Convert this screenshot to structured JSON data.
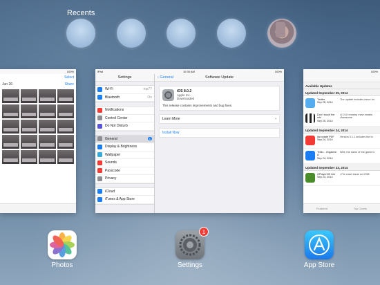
{
  "recents": {
    "title": "Recents",
    "contacts": 5
  },
  "photos_card": {
    "status": "100%",
    "nav_select": "Select",
    "date": "Jun 26",
    "share": "Share"
  },
  "settings_card": {
    "status_left": "iPad",
    "status_time": "10:30 AM",
    "status_right": "100%",
    "sidebar_title": "Settings",
    "items": [
      {
        "label": "Wi-Fi",
        "value": "mp77",
        "color": "#1a7ef2"
      },
      {
        "label": "Bluetooth",
        "value": "On",
        "color": "#1a7ef2"
      },
      {
        "label": "Notifications",
        "value": "",
        "color": "#f23b35"
      },
      {
        "label": "Control Center",
        "value": "",
        "color": "#8e8e93"
      },
      {
        "label": "Do Not Disturb",
        "value": "",
        "color": "#5856d6"
      },
      {
        "label": "General",
        "badge": "1",
        "color": "#8e8e93"
      },
      {
        "label": "Display & Brightness",
        "value": "",
        "color": "#1a7ef2"
      },
      {
        "label": "Wallpaper",
        "value": "",
        "color": "#34aadc"
      },
      {
        "label": "Sounds",
        "value": "",
        "color": "#f23b35"
      },
      {
        "label": "Passcode",
        "value": "",
        "color": "#f23b35"
      },
      {
        "label": "Privacy",
        "value": "",
        "color": "#8e8e93"
      },
      {
        "label": "iCloud",
        "value": "",
        "color": "#1a7ef2"
      },
      {
        "label": "iTunes & App Store",
        "value": "",
        "color": "#1a7ef2"
      }
    ],
    "back": "General",
    "page_title": "Software Update",
    "update": {
      "version": "iOS 8.0.2",
      "company": "Apple Inc.",
      "status": "Downloaded",
      "description": "This release contains improvements and bug fixes."
    },
    "learn_more": "Learn More",
    "install": "Install Now"
  },
  "appstore_card": {
    "status": "100%",
    "available": "Available Updates",
    "sections": [
      {
        "header": "Updated September 25, 2014",
        "apps": [
          {
            "name": "Twitter",
            "date": "Sep 25, 2014",
            "desc": "The update includes minor im",
            "color": "#55acee"
          },
          {
            "name": "Don't touch the whi",
            "date": "Sep 25, 2014",
            "desc": "•2.0 UI revamp •new modes •Awesome",
            "color": "#222222"
          }
        ]
      },
      {
        "header": "Updated September 24, 2014",
        "apps": [
          {
            "name": "iAnnotate PDF",
            "date": "Sep 24, 2014",
            "desc": "Version 3.1.1 includes the fo",
            "color": "#f23b35"
          },
          {
            "name": "Trello - Organize A",
            "date": "Sep 24, 2014",
            "desc": "Well, the name of the game is",
            "color": "#1a7ef2"
          }
        ]
      },
      {
        "header": "Updated September 23, 2014",
        "apps": [
          {
            "name": "OPlayerHD Lite",
            "date": "Sep 23, 2014",
            "desc": "• Fix crash issue on iOS8",
            "color": "#4a8c2a"
          }
        ]
      }
    ],
    "tabs": [
      "Featured",
      "Top Charts"
    ]
  },
  "dock": {
    "photos": "Photos",
    "settings": "Settings",
    "settings_badge": "1",
    "appstore": "App Store"
  }
}
